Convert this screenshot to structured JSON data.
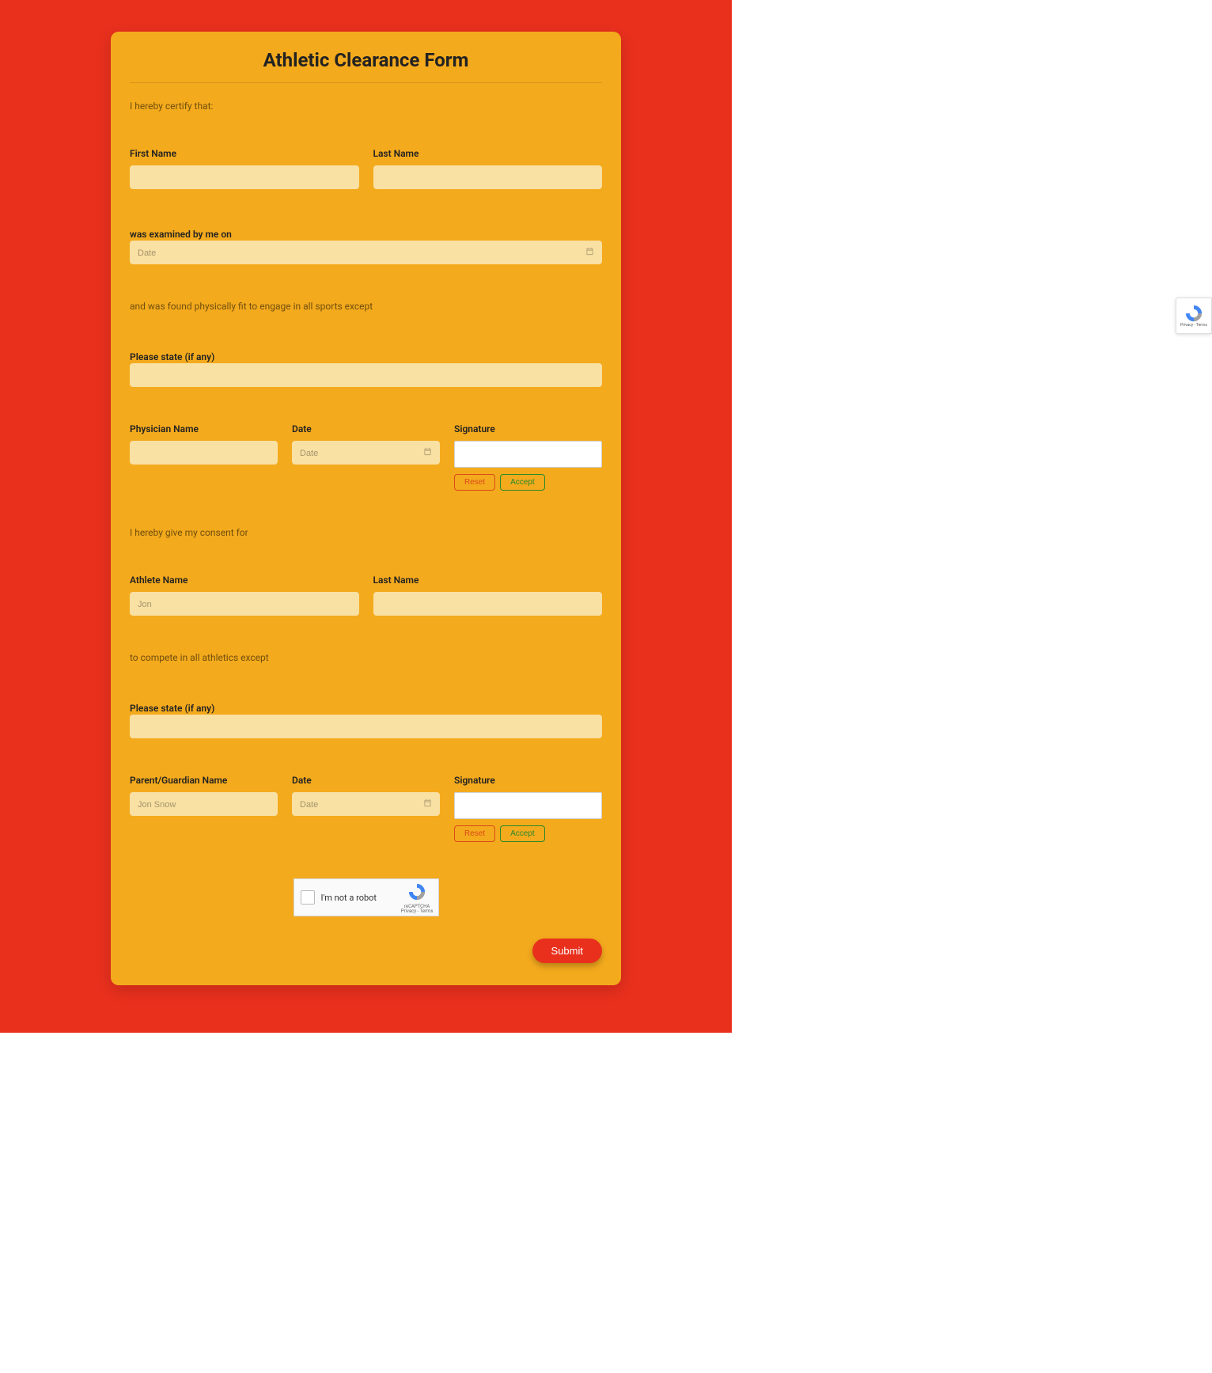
{
  "title": "Athletic Clearance Form",
  "certify_text": "I hereby certify that:",
  "first_name_label": "First Name",
  "last_name_label": "Last Name",
  "examined_label": "was examined by me on",
  "date_placeholder": "Date",
  "found_fit_text": "and was found physically fit to engage in all sports except",
  "please_state_label": "Please state (if any)",
  "physician_name_label": "Physician Name",
  "date_label": "Date",
  "signature_label": "Signature",
  "reset_label": "Reset",
  "accept_label": "Accept",
  "consent_text": "I hereby give my consent for",
  "athlete_name_label": "Athlete Name",
  "athlete_name_placeholder": "Jon",
  "compete_text": "to compete in all athletics except",
  "parent_name_label": "Parent/Guardian Name",
  "parent_name_placeholder": "Jon Snow",
  "recaptcha_label": "I'm not a robot",
  "recaptcha_brand": "reCAPTCHA",
  "recaptcha_terms": "Privacy - Terms",
  "submit_label": "Submit"
}
